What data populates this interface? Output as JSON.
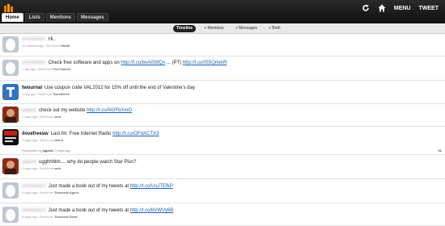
{
  "nav": {
    "tabs": [
      "Home",
      "Lists",
      "Mentions",
      "Messages"
    ],
    "menu_label": "MENU",
    "tweet_label": "TWEET"
  },
  "filters": [
    "Timeline",
    "+ Mentions",
    "+ Messages",
    "+ Both"
  ],
  "tweets": [
    {
      "user": "arvindnair0",
      "text": "Hi..",
      "meta_prefix": "12 minutes ago. Sent from ",
      "source": "Hatita"
    },
    {
      "user": "arvindnair0",
      "text": "Check free software and apps on ",
      "link1": "http://t.co/bvAtStlfQs",
      "mid": " ... (PT) ",
      "link2": "http://t.co/IS5QrIenR",
      "meta_prefix": "1 day ago. Sent from ",
      "source": "FreeTweeta"
    },
    {
      "user": "twournal",
      "text": "Use coupon code VAL2012 for 15% off until the end of Valentine's day",
      "meta_prefix": "1 day ago. Sent from ",
      "source": "TweetDeck"
    },
    {
      "user": "jagarib",
      "text": "check out my website ",
      "link1": "http://t.co/NGFbXmO",
      "meta_prefix": "2 days ago. Sent from ",
      "source": "web"
    },
    {
      "user": "ilovefreesw",
      "text": "Last.fm: Free Internet Radio ",
      "link1": "http://t.co/OFdACTX3",
      "meta_prefix": "3 days ago. Sent from ",
      "source": "dlvr.it",
      "retweeted_by_prefix": "Retweeted by ",
      "retweeted_by": "jagarib",
      "retweeted_suffix": ", 3 days ago",
      "rt_count": "51"
    },
    {
      "user": "jagarib",
      "text": "ugghhhhh.... why do people watch Star Plus?",
      "meta_prefix": "3 days ago. Sent from ",
      "source": "web"
    },
    {
      "user": "arvindnair0",
      "text": "Just made a book out of my tweets at ",
      "link1": "http://t.co/UsJTEfkP",
      "meta_prefix": "4 days ago. Sent from ",
      "source": "Twournal Agent"
    },
    {
      "user": "arvindnair0",
      "text": "Just made a book out of my tweets at ",
      "link1": "http://t.co/bVWVy6B",
      "meta_prefix": "4 days ago. Sent from ",
      "source": "Twournal Send"
    }
  ],
  "colors": {
    "topbar": "#111111",
    "link": "#1f5fae",
    "active_pill": "#222222"
  },
  "icons": [
    "logo-icon",
    "refresh-icon",
    "home-icon",
    "default-avatar-icon"
  ]
}
